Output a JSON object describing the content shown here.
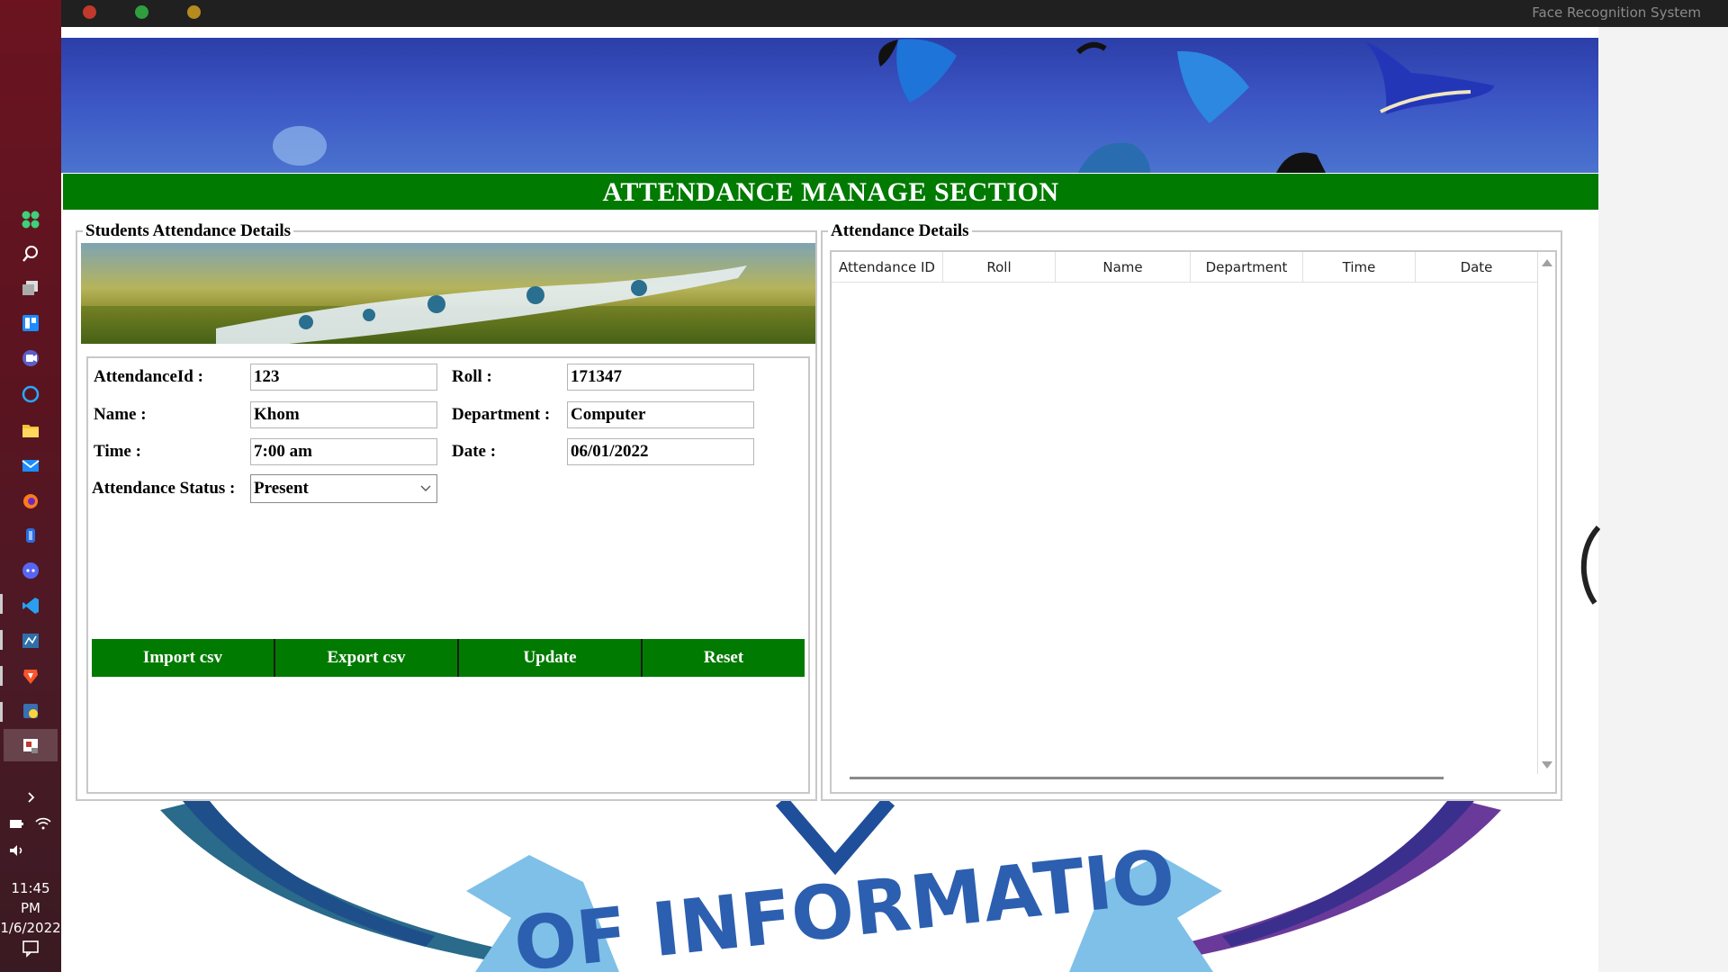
{
  "taskbar": {
    "time": "11:45 PM",
    "date": "1/6/2022",
    "icons": [
      "grid-app-icon",
      "search-icon",
      "task-view-icon",
      "widgets-icon",
      "teams-icon",
      "cortana-icon",
      "file-explorer-icon",
      "mail-icon",
      "firefox-icon",
      "onedrive-icon",
      "discord-icon",
      "vscode-icon",
      "settings-icon",
      "brave-icon",
      "python-icon",
      "face-app-icon"
    ]
  },
  "window": {
    "title": "Face Recognition System"
  },
  "header": {
    "section_title": "ATTENDANCE MANAGE SECTION"
  },
  "left_panel": {
    "legend": "Students Attendance  Details",
    "fields": {
      "attendance_id_label": "AttendanceId :",
      "attendance_id_value": "123",
      "roll_label": "Roll :",
      "roll_value": "171347",
      "name_label": "Name :",
      "name_value": "Khom",
      "department_label": "Department :",
      "department_value": "Computer",
      "time_label": "Time :",
      "time_value": "7:00 am",
      "date_label": "Date :",
      "date_value": "06/01/2022",
      "status_label": "Attendance Status :",
      "status_value": "Present"
    },
    "buttons": {
      "import": "Import csv",
      "export": "Export csv",
      "update": "Update",
      "reset": "Reset"
    }
  },
  "right_panel": {
    "legend": "Attendance Details",
    "columns": [
      "Attendance ID",
      "Roll",
      "Name",
      "Department",
      "Time",
      "Date"
    ],
    "rows": []
  },
  "logo": {
    "text": "OF INFORMATIO"
  },
  "colors": {
    "accent_green": "#007a00",
    "banner_blue": "#3b55c4",
    "taskbar": "#5a1420"
  }
}
